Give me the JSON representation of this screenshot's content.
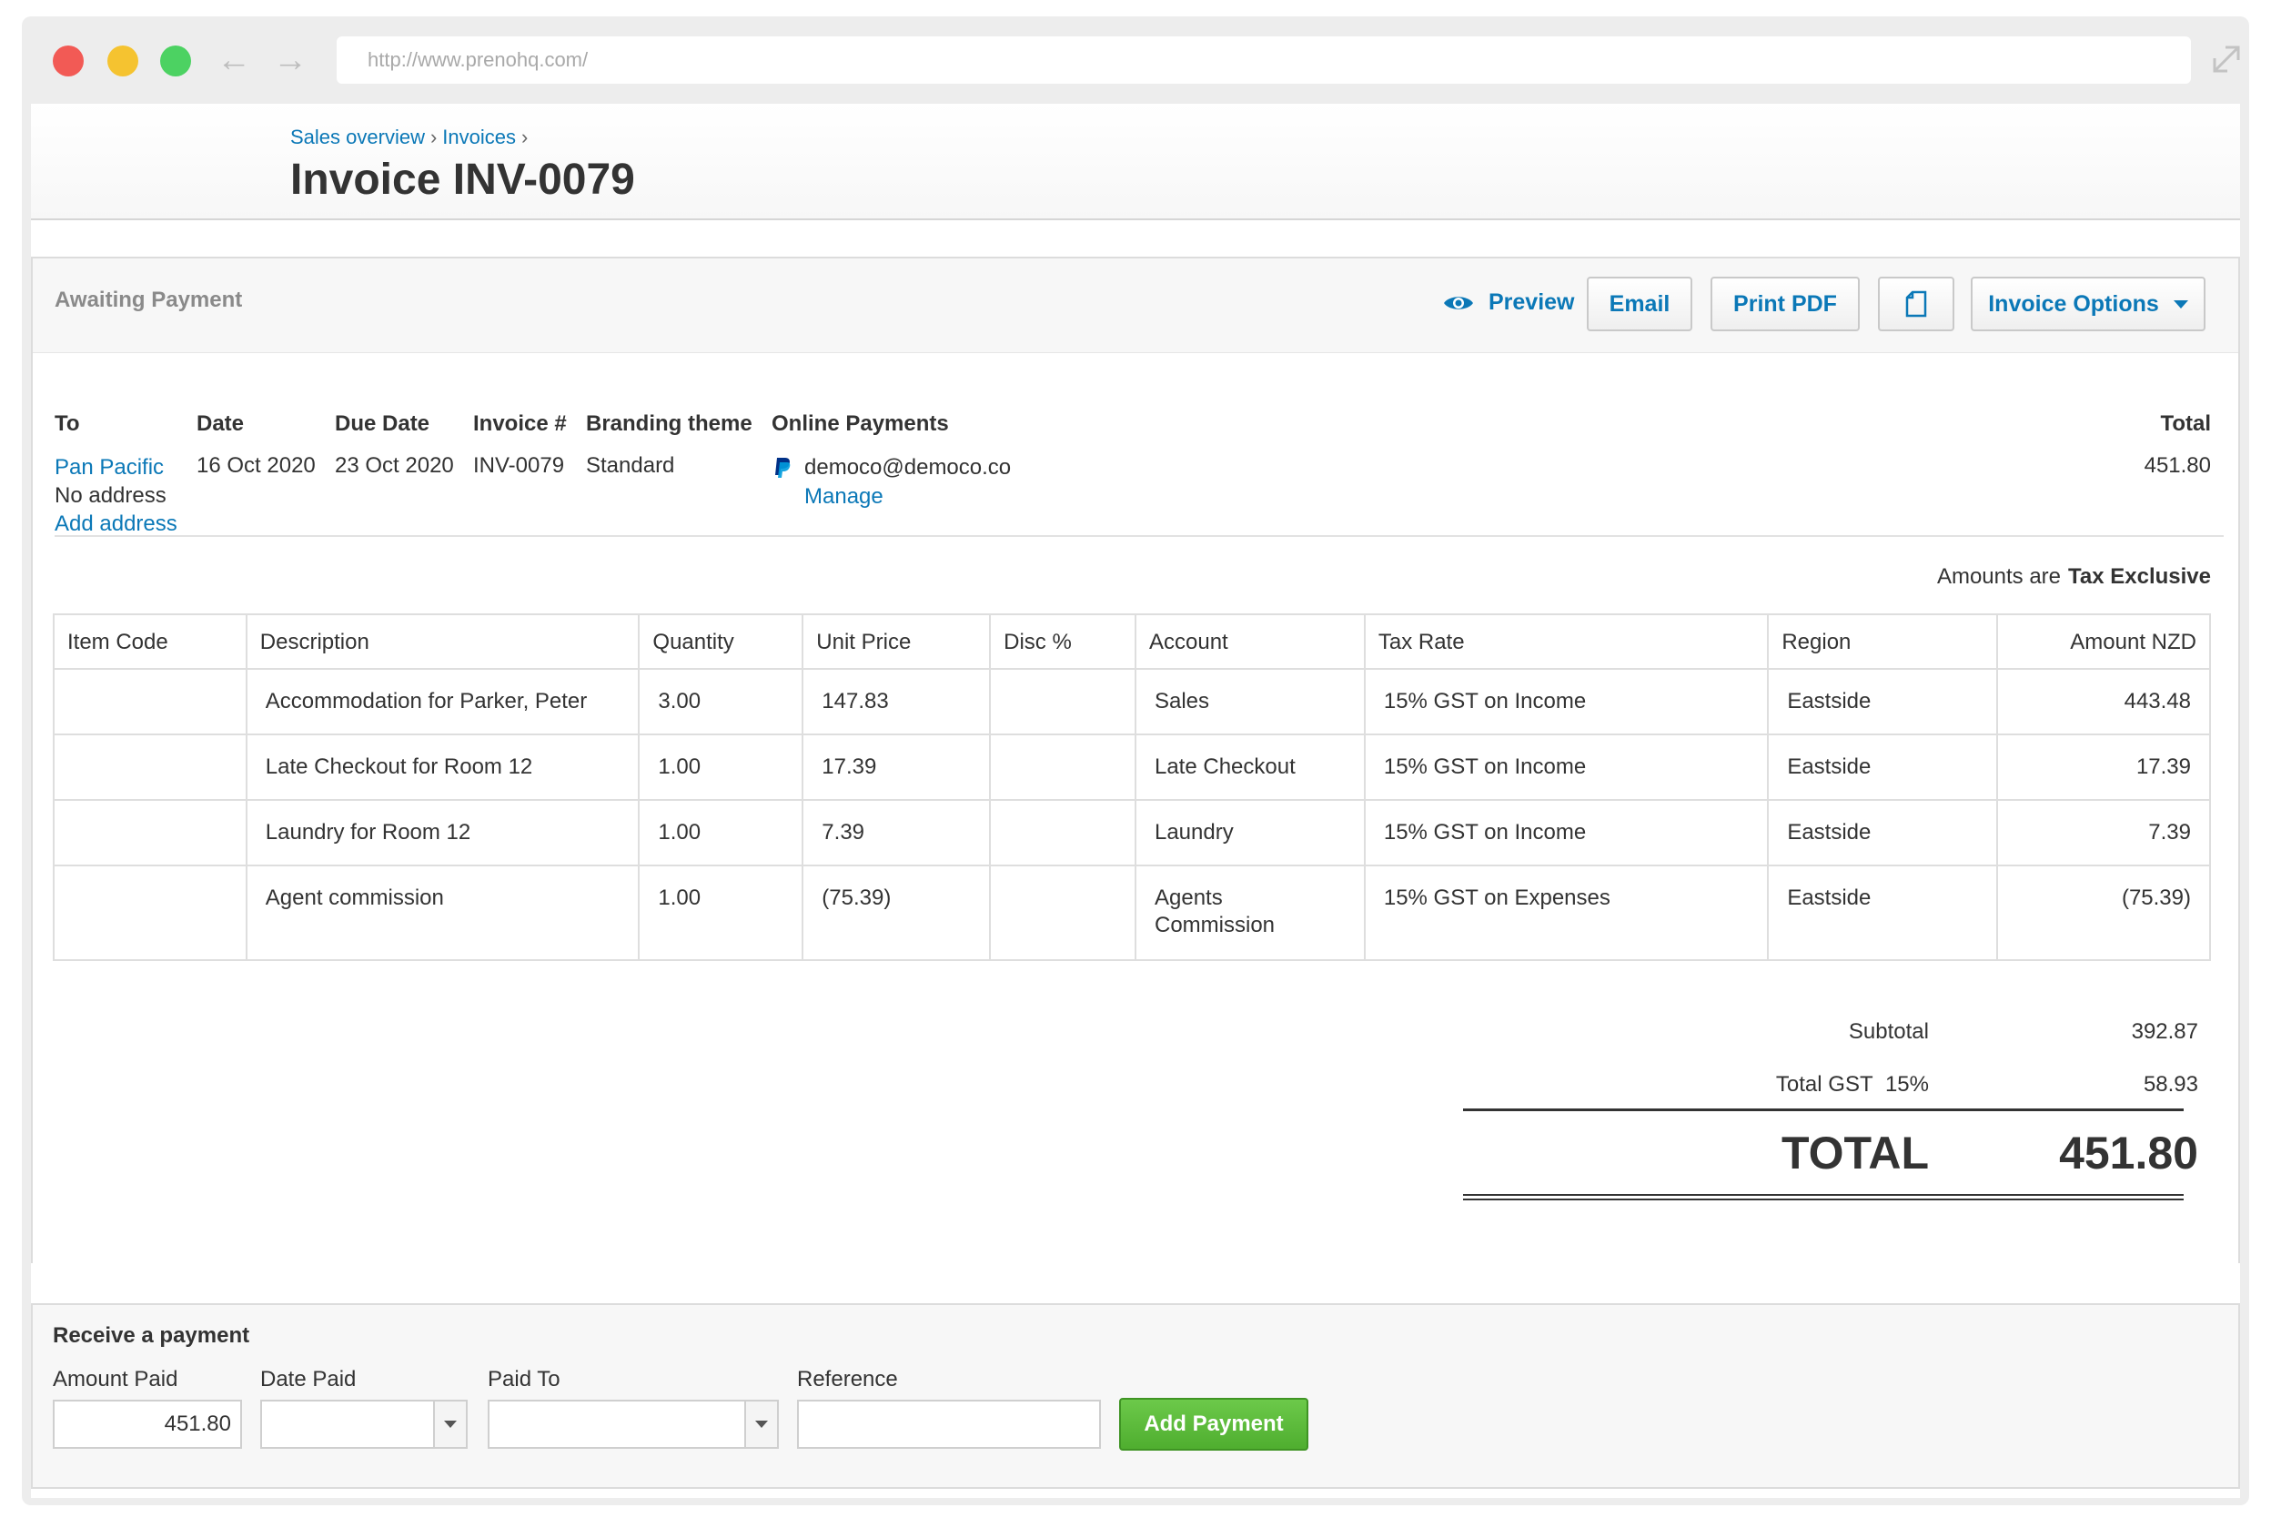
{
  "browser": {
    "url": "http://www.prenohq.com/"
  },
  "header": {
    "breadcrumb": [
      "Sales overview",
      "Invoices"
    ],
    "breadcrumb_sep": "›",
    "title": "Invoice INV-0079"
  },
  "toolbar": {
    "status": "Awaiting Payment",
    "preview": "Preview",
    "email": "Email",
    "print_pdf": "Print PDF",
    "invoice_options": "Invoice Options"
  },
  "meta": {
    "labels": {
      "to": "To",
      "date": "Date",
      "due_date": "Due Date",
      "invoice_no": "Invoice #",
      "branding": "Branding theme",
      "online_payments": "Online Payments",
      "total": "Total"
    },
    "to_name": "Pan Pacific",
    "to_address": "No address",
    "add_address": "Add address",
    "date": "16 Oct 2020",
    "due_date": "23 Oct 2020",
    "invoice_no": "INV-0079",
    "branding": "Standard",
    "payment_email": "democo@democo.co",
    "manage": "Manage",
    "total": "451.80"
  },
  "tax_note": {
    "prefix": "Amounts are",
    "mode": "Tax Exclusive"
  },
  "table": {
    "headers": [
      "Item Code",
      "Description",
      "Quantity",
      "Unit Price",
      "Disc %",
      "Account",
      "Tax Rate",
      "Region",
      "Amount NZD"
    ],
    "rows": [
      {
        "item_code": "",
        "description": "Accommodation for Parker, Peter",
        "quantity": "3.00",
        "unit_price": "147.83",
        "disc": "",
        "account": "Sales",
        "tax_rate": "15% GST on Income",
        "region": "Eastside",
        "amount": "443.48"
      },
      {
        "item_code": "",
        "description": "Late Checkout for Room 12",
        "quantity": "1.00",
        "unit_price": "17.39",
        "disc": "",
        "account": "Late Checkout",
        "tax_rate": "15% GST on Income",
        "region": "Eastside",
        "amount": "17.39"
      },
      {
        "item_code": "",
        "description": "Laundry for Room 12",
        "quantity": "1.00",
        "unit_price": "7.39",
        "disc": "",
        "account": "Laundry",
        "tax_rate": "15% GST on Income",
        "region": "Eastside",
        "amount": "7.39"
      },
      {
        "item_code": "",
        "description": "Agent commission",
        "quantity": "1.00",
        "unit_price": "(75.39)",
        "disc": "",
        "account_line1": "Agents",
        "account_line2": "Commission",
        "tax_rate": "15% GST on Expenses",
        "region": "Eastside",
        "amount": "(75.39)"
      }
    ]
  },
  "totals": {
    "subtotal_label": "Subtotal",
    "subtotal": "392.87",
    "gst_label": "Total GST",
    "gst_rate": "15%",
    "gst": "58.93",
    "total_label": "TOTAL",
    "total": "451.80"
  },
  "payment": {
    "title": "Receive a payment",
    "amount_label": "Amount Paid",
    "amount_value": "451.80",
    "date_label": "Date Paid",
    "paid_to_label": "Paid To",
    "reference_label": "Reference",
    "add_button": "Add Payment"
  },
  "colors": {
    "link": "#0b78b7",
    "add_payment": "#5cb83a",
    "paypal_dark": "#003087",
    "paypal_light": "#009cde"
  }
}
